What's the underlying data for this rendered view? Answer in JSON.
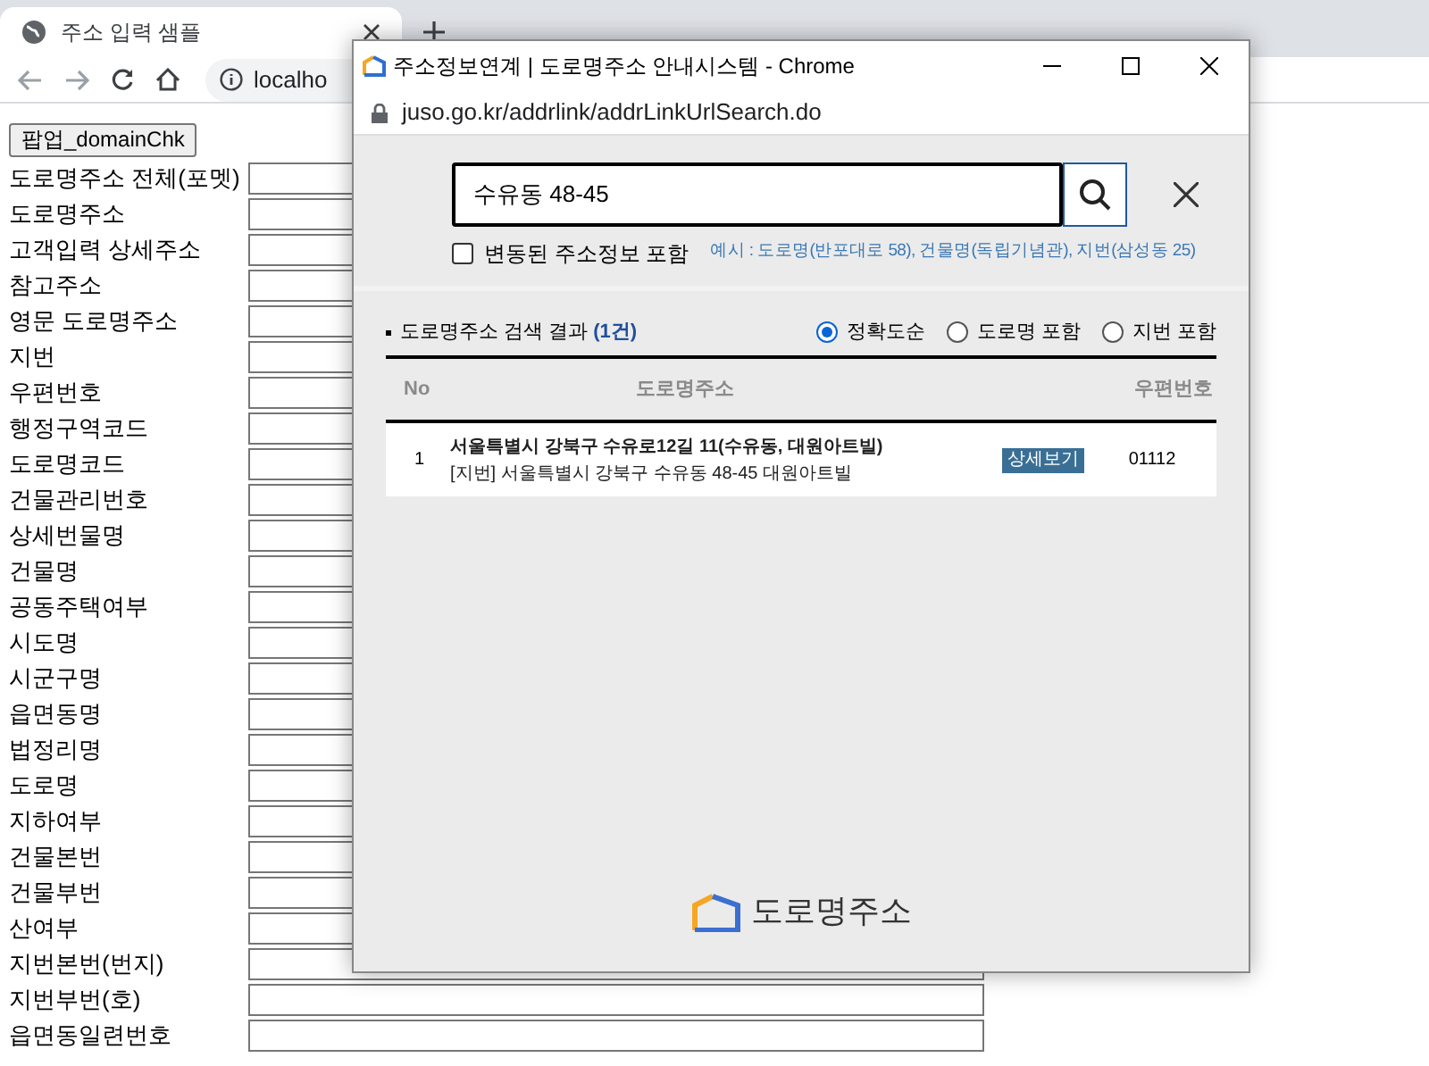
{
  "browser": {
    "tab_title": "주소 입력 샘플",
    "address": "localho"
  },
  "form": {
    "button": "팝업_domainChk",
    "fields": [
      "도로명주소 전체(포멧)",
      "도로명주소",
      "고객입력 상세주소",
      "참고주소",
      "영문 도로명주소",
      "지번",
      "우편번호",
      "행정구역코드",
      "도로명코드",
      "건물관리번호",
      "상세번물명",
      "건물명",
      "공동주택여부",
      "시도명",
      "시군구명",
      "읍면동명",
      "법정리명",
      "도로명",
      "지하여부",
      "건물본번",
      "건물부번",
      "산여부",
      "지번본번(번지)",
      "지번부번(호)",
      "읍면동일련번호"
    ]
  },
  "popup": {
    "title": "주소정보연계 | 도로명주소 안내시스템 - Chrome",
    "url": "juso.go.kr/addrlink/addrLinkUrlSearch.do",
    "search_value": "수유동 48-45",
    "checkbox": {
      "label": "변동된 주소정보 포함",
      "checked": false
    },
    "example": "예시 : 도로명(반포대로 58), 건물명(독립기념관), 지번(삼성동 25)",
    "results_title": "도로명주소 검색 결과",
    "results_count": "(1건)",
    "sort_options": [
      {
        "label": "정확도순",
        "selected": true
      },
      {
        "label": "도로명 포함",
        "selected": false
      },
      {
        "label": "지번 포함",
        "selected": false
      }
    ],
    "columns": [
      "No",
      "도로명주소",
      "우편번호"
    ],
    "rows": [
      {
        "no": "1",
        "road": "서울특별시 강북구 수유로12길 11(수유동, 대원아트빌)",
        "jibun": "[지번] 서울특별시 강북구 수유동 48-45 대원아트빌",
        "detail_button": "상세보기",
        "zip": "01112"
      }
    ],
    "logo_text": "도로명주소"
  }
}
